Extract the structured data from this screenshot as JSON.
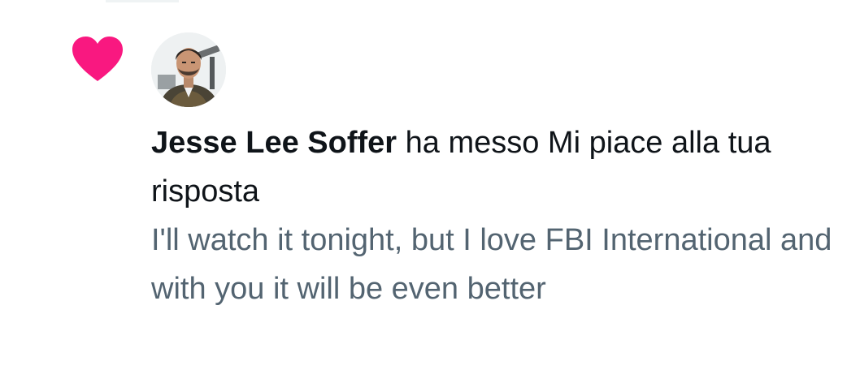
{
  "notification": {
    "type_icon": "heart-icon",
    "avatar_icon": "avatar",
    "actor_name": "Jesse Lee Soffer",
    "action_text": " ha messo Mi piace alla tua risposta",
    "reply_text": "I'll watch it tonight, but I love FBI International and with you it will be even better"
  },
  "colors": {
    "heart": "#f91880",
    "primary_text": "#0f1419",
    "secondary_text": "#536471"
  }
}
